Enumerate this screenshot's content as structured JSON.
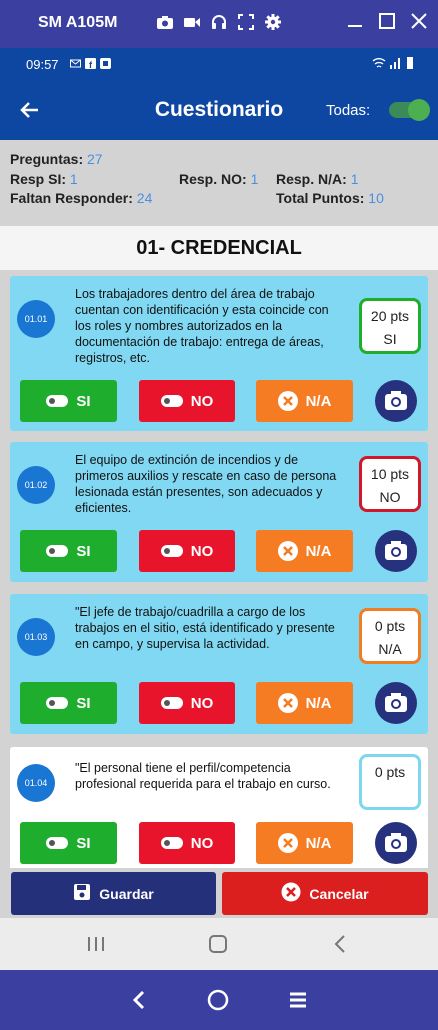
{
  "window": {
    "title": "SM A105M"
  },
  "status": {
    "time": "09:57"
  },
  "appbar": {
    "title": "Cuestionario",
    "todas_label": "Todas:"
  },
  "summary": {
    "preguntas_label": "Preguntas:",
    "preguntas": "27",
    "resp_si_label": "Resp SI:",
    "resp_si": "1",
    "resp_no_label": "Resp. NO:",
    "resp_no": "1",
    "resp_na_label": "Resp. N/A:",
    "resp_na": "1",
    "faltan_label": "Faltan Responder:",
    "faltan": "24",
    "total_label": "Total Puntos:",
    "total": "10"
  },
  "section": {
    "title": "01- CREDENCIAL"
  },
  "buttons": {
    "si": "SI",
    "no": "NO",
    "na": "N/A"
  },
  "questions": [
    {
      "num": "01.01",
      "text": "Los trabajadores dentro del área de trabajo cuentan con identificación y esta coincide con los roles y nombres autorizados en la documentación de trabajo: entrega de áreas, registros, etc.",
      "pts": "20 pts",
      "answer": "SI",
      "border": "#1fad2d"
    },
    {
      "num": "01.02",
      "text": "El equipo de extinción de incendios y de primeros auxilios y rescate en caso de persona lesionada están presentes, son adecuados y eficientes.",
      "pts": "10 pts",
      "answer": "NO",
      "border": "#d0182a"
    },
    {
      "num": "01.03",
      "text": "\"El jefe de trabajo/cuadrilla a cargo de los trabajos en el sitio, está identificado y presente en campo, y supervisa la actividad.",
      "pts": "0 pts",
      "answer": "N/A",
      "border": "#ef7d22"
    },
    {
      "num": "01.04",
      "text": "\"El personal tiene el perfil/competencia profesional requerida para el trabajo en curso.",
      "pts": "0 pts",
      "answer": "",
      "border": "#7fd6f0"
    }
  ],
  "footer": {
    "save": "Guardar",
    "cancel": "Cancelar"
  }
}
